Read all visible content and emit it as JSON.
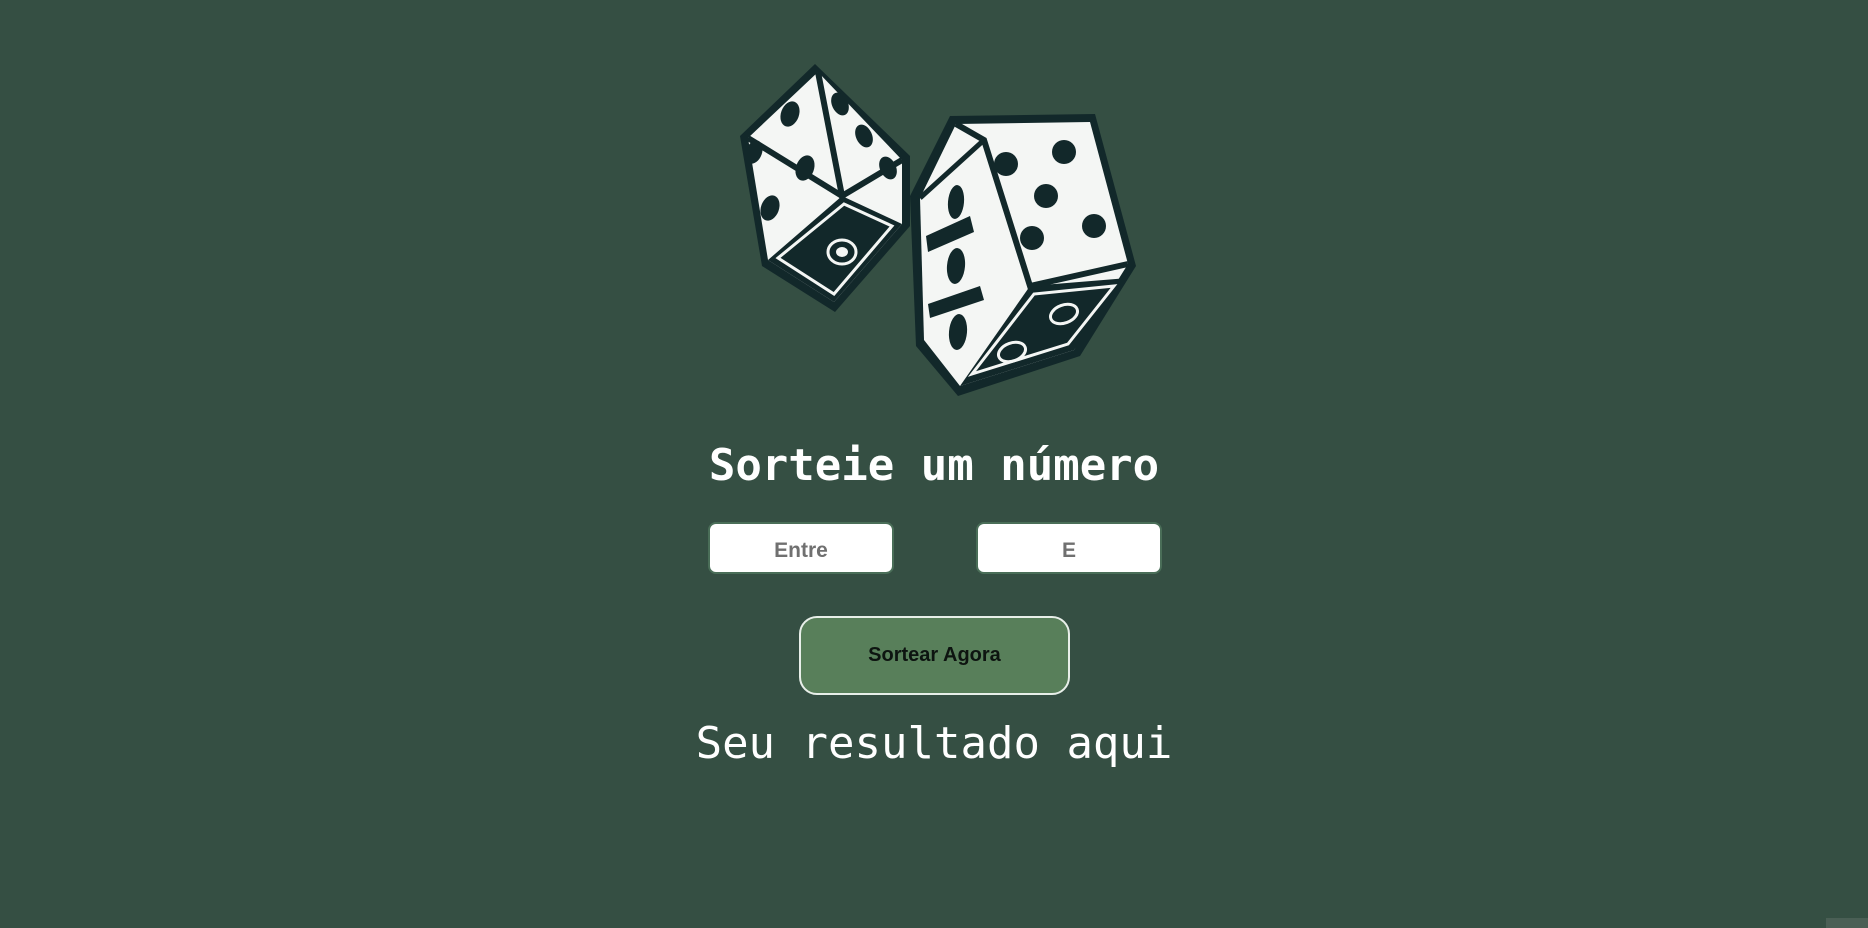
{
  "main": {
    "image": {
      "icon": "dice-icon"
    },
    "title": "Sorteie um número",
    "min_input": {
      "placeholder": "Entre",
      "value": ""
    },
    "max_input": {
      "placeholder": "E",
      "value": ""
    },
    "draw_button_label": "Sortear Agora",
    "result_text": "Seu resultado aqui"
  },
  "colors": {
    "background": "#354f43",
    "button": "#587f5a",
    "dice_dark": "#12282a",
    "text": "#ffffff"
  }
}
